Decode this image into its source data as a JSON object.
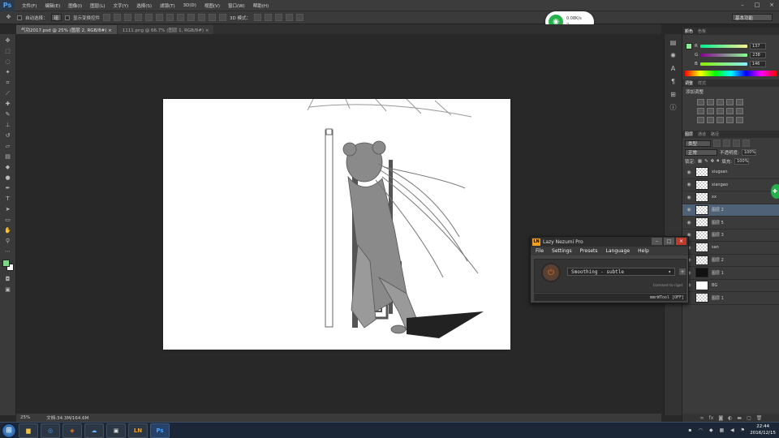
{
  "app": {
    "logo": "Ps"
  },
  "menu": [
    "文件(F)",
    "编辑(E)",
    "图像(I)",
    "图层(L)",
    "文字(Y)",
    "选择(S)",
    "滤镜(T)",
    "3D(D)",
    "视图(V)",
    "窗口(W)",
    "帮助(H)"
  ],
  "options_bar": {
    "auto_select": "自动选择：",
    "auto_select_value": "组",
    "show_transform": "显示变换控件",
    "mode_3d": "3D 模式：",
    "workspace": "基本功能"
  },
  "network": {
    "speed": "0.08K/s",
    "count": "2"
  },
  "tabs": [
    "气功2017.psd @ 25% (图层 2, RGB/8#) ×",
    "1111.png @ 66.7% (图层 1, RGB/8#) ×"
  ],
  "status": {
    "zoom": "25%",
    "doc": "文档:34.3M/164.6M"
  },
  "color_panel": {
    "tabs": [
      "颜色",
      "色板"
    ],
    "r_label": "R",
    "g_label": "G",
    "b_label": "B",
    "r": "137",
    "g": "238",
    "b": "146",
    "fg_color": "#89ee92"
  },
  "adjust_panel": {
    "tabs": [
      "调整",
      "样式"
    ],
    "title": "添加调整"
  },
  "layers_panel": {
    "tabs": [
      "图层",
      "通道",
      "路径"
    ],
    "kind": "类型",
    "blend": "正常",
    "opacity_label": "不透明度:",
    "opacity": "100%",
    "lock_label": "锁定:",
    "fill_label": "填充:",
    "fill": "100%",
    "layers": [
      {
        "name": "xiugsan"
      },
      {
        "name": "xiangao"
      },
      {
        "name": "xx"
      },
      {
        "name": "图层 2"
      },
      {
        "name": "图层 5"
      },
      {
        "name": "图层 3"
      },
      {
        "name": "san"
      },
      {
        "name": "图层 2"
      },
      {
        "name": "图层 1"
      },
      {
        "name": "BG"
      },
      {
        "name": "图层 1"
      }
    ]
  },
  "lazy_nezumi": {
    "badge": "LN",
    "title": "Lazy Nezumi Pro",
    "menu": [
      "File",
      "Settings",
      "Presets",
      "Language",
      "Help"
    ],
    "preset": "Smoothing - subtle",
    "licensed": "licensed to rigel",
    "status": "mmrWTool [OFF]"
  },
  "taskbar": {
    "ln_label": "LN",
    "ps_label": "Ps",
    "time": "22:44",
    "date": "2016/12/15"
  }
}
